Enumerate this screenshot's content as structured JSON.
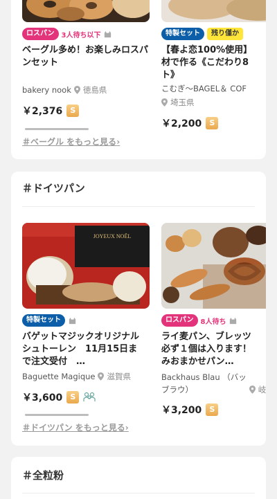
{
  "sections": [
    {
      "title": "",
      "more_link": "＃ベーグル をもっと見る",
      "more_chevron": "›",
      "products": [
        {
          "badge": "ロスパン",
          "badge_color": "#e3337a",
          "wait_text": "3人待ち以下",
          "title": "ベーグル多め！お楽しみロスパンセット",
          "seller": "bakery nook",
          "location": "徳島県",
          "price": "￥2,376",
          "coin_icon": "coin-icon"
        },
        {
          "badge": "特製セット",
          "badge_color": "#0c5ea8",
          "extra_badge": "残り僅か",
          "title": "【春よ恋100%使用】\n材で作る《こだわり8\nト》",
          "seller": "こむぎ〜BAGEL＆ COF",
          "location": "埼玉県",
          "price": "￥2,200",
          "coin_icon": "coin-icon"
        }
      ]
    },
    {
      "title": "＃ドイツパン",
      "more_link": "＃ドイツパン をもっと見る",
      "more_chevron": "›",
      "products": [
        {
          "badge": "特製セット",
          "badge_color": "#0c5ea8",
          "title": "バゲットマジックオリジナル\nシュトーレン　11月15日ま\nで注文受付　…",
          "seller": "Baguette Magique",
          "location": "滋賀県",
          "price": "￥3,600",
          "coin_icon": "coin-icon",
          "image_text": "JOYEUX NOËL"
        },
        {
          "badge": "ロスパン",
          "badge_color": "#e3337a",
          "wait_text": "8人待ち",
          "title": "ライ麦パン、ブレッツ\n必ず１個は入ります！\nみおまかせパン…",
          "seller": "Backhaus Blau （バッ\nブラウ）",
          "location": "岐阜県",
          "price": "￥3,200",
          "coin_icon": "coin-icon"
        }
      ]
    },
    {
      "title": "＃全粒粉"
    }
  ]
}
